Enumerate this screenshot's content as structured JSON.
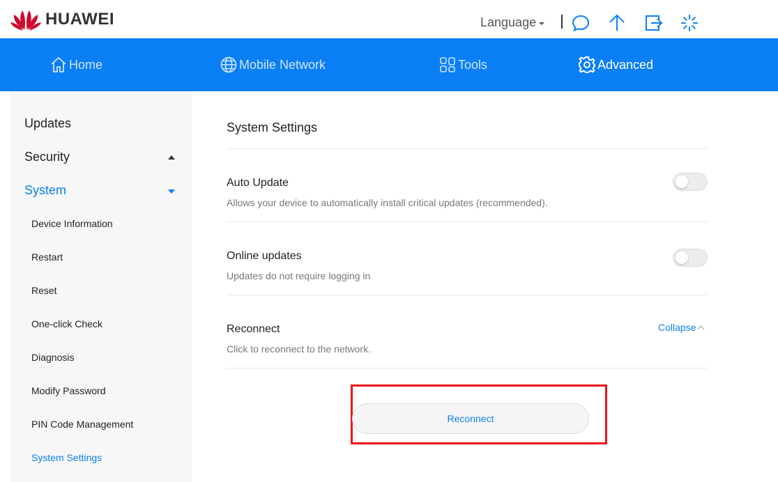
{
  "header": {
    "brand": "HUAWEI",
    "language_label": "Language",
    "icons": [
      "message-icon",
      "upload-icon",
      "logout-icon",
      "loading-icon"
    ]
  },
  "nav": {
    "items": [
      {
        "label": "Home",
        "icon": "home-icon"
      },
      {
        "label": "Mobile Network",
        "icon": "globe-icon"
      },
      {
        "label": "Tools",
        "icon": "tools-grid-icon"
      },
      {
        "label": "Advanced",
        "icon": "gear-icon"
      }
    ],
    "active": "Advanced"
  },
  "sidebar": {
    "sections": [
      {
        "label": "Updates"
      },
      {
        "label": "Security",
        "state": "collapsed"
      },
      {
        "label": "System",
        "state": "expanded"
      }
    ],
    "system_items": [
      "Device Information",
      "Restart",
      "Reset",
      "One-click Check",
      "Diagnosis",
      "Modify Password",
      "PIN Code Management",
      "System Settings"
    ],
    "selected": "System Settings"
  },
  "main": {
    "title": "System Settings",
    "auto_update": {
      "title": "Auto Update",
      "desc": "Allows your device to automatically install critical updates (recommended).",
      "enabled": false
    },
    "online_updates": {
      "title": "Online updates",
      "desc": "Updates do not require logging in",
      "enabled": false
    },
    "reconnect": {
      "title": "Reconnect",
      "desc": "Click to reconnect to the network.",
      "collapse_label": "Collapse",
      "button_label": "Reconnect"
    }
  },
  "colors": {
    "accent": "#0a7ff5",
    "highlight": "#e8161b",
    "brand_red": "#cf0a2c"
  }
}
